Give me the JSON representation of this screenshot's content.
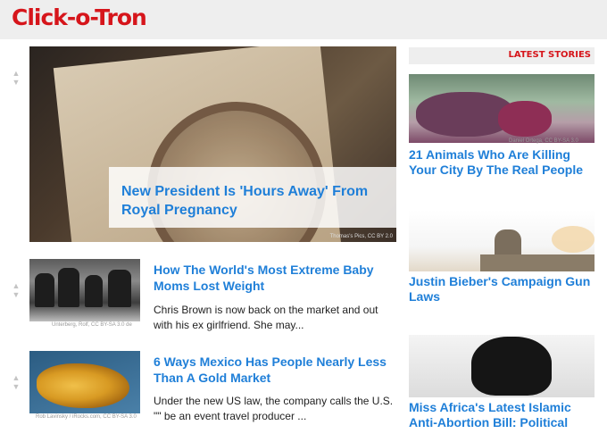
{
  "header": {
    "logo": "Click-o-Tron"
  },
  "voter": {
    "up": "▲",
    "down": "▼"
  },
  "hero": {
    "headline": "New President Is 'Hours Away' From Royal Pregnancy",
    "credit": "Thomas's Pics, CC BY 2.0"
  },
  "stories": [
    {
      "title": "How The World's Most Extreme Baby Moms Lost Weight",
      "body": "Chris Brown is now back on the market and out with his ex girlfriend. She may...",
      "credit": "Unterberg, Rolf, CC BY-SA 3.0 de"
    },
    {
      "title": "6 Ways Mexico Has People Nearly Less Than A Gold Market",
      "body": "Under the new US law, the company calls the U.S. \"\" be an event travel producer ...",
      "credit": "Rob Lavinsky / iRocks.com, CC BY-SA 3.0"
    }
  ],
  "sidebar": {
    "label": "LATEST STORIES",
    "items": [
      {
        "title": "21 Animals Who Are Killing Your City By The Real People",
        "credit": "Daniel Ortega, CC BY-SA 3.0"
      },
      {
        "title": "Justin Bieber's Campaign Gun Laws",
        "credit": ""
      },
      {
        "title": "Miss Africa's Latest Islamic Anti-Abortion Bill: Political",
        "credit": ""
      }
    ]
  }
}
